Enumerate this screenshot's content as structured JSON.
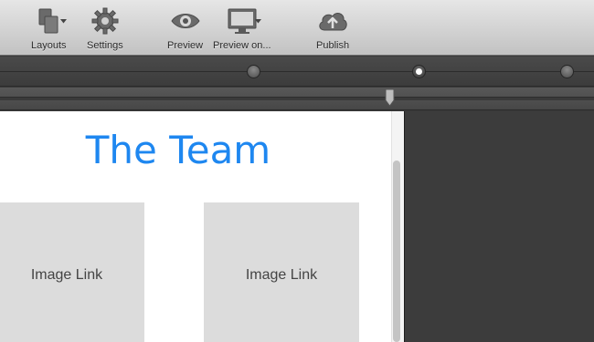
{
  "toolbar": {
    "layouts_label": "Layouts",
    "settings_label": "Settings",
    "preview_label": "Preview",
    "preview_on_label": "Preview on...",
    "publish_label": "Publish"
  },
  "canvas": {
    "title": "The Team",
    "image_links": [
      "Image Link",
      "Image Link"
    ]
  },
  "colors": {
    "title_blue": "#1e87f0",
    "toolbar_bg": "#d2d2d2",
    "dark_panel": "#3c3c3c"
  }
}
